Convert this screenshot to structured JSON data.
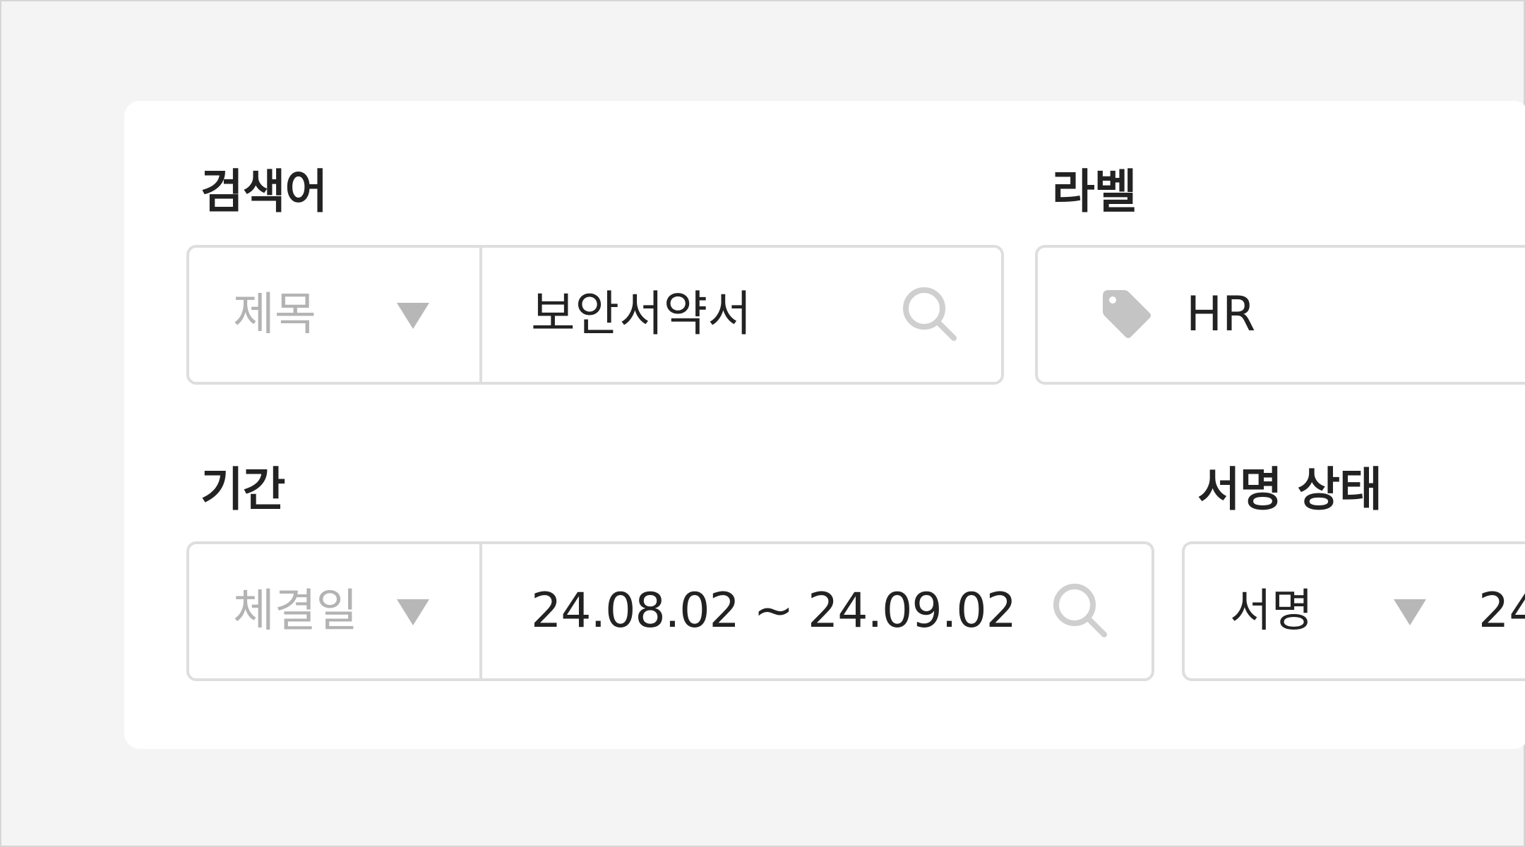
{
  "search": {
    "label": "검색어",
    "type_value": "제목",
    "query_value": "보안서약서"
  },
  "label_filter": {
    "label": "라벨",
    "value": "HR"
  },
  "period": {
    "label": "기간",
    "type_value": "체결일",
    "range_value": "24.08.02 ~ 24.09.02"
  },
  "sign_status": {
    "label": "서명 상태",
    "type_value": "서명",
    "value_partial": "24"
  },
  "colors": {
    "page_bg": "#f4f4f4",
    "card_bg": "#ffffff",
    "border": "#dedede",
    "muted_text": "#b3b3b3",
    "icon_gray": "#c4c4c4",
    "text": "#222222"
  },
  "icons": [
    "chevron-down-icon",
    "search-icon",
    "tag-icon"
  ]
}
